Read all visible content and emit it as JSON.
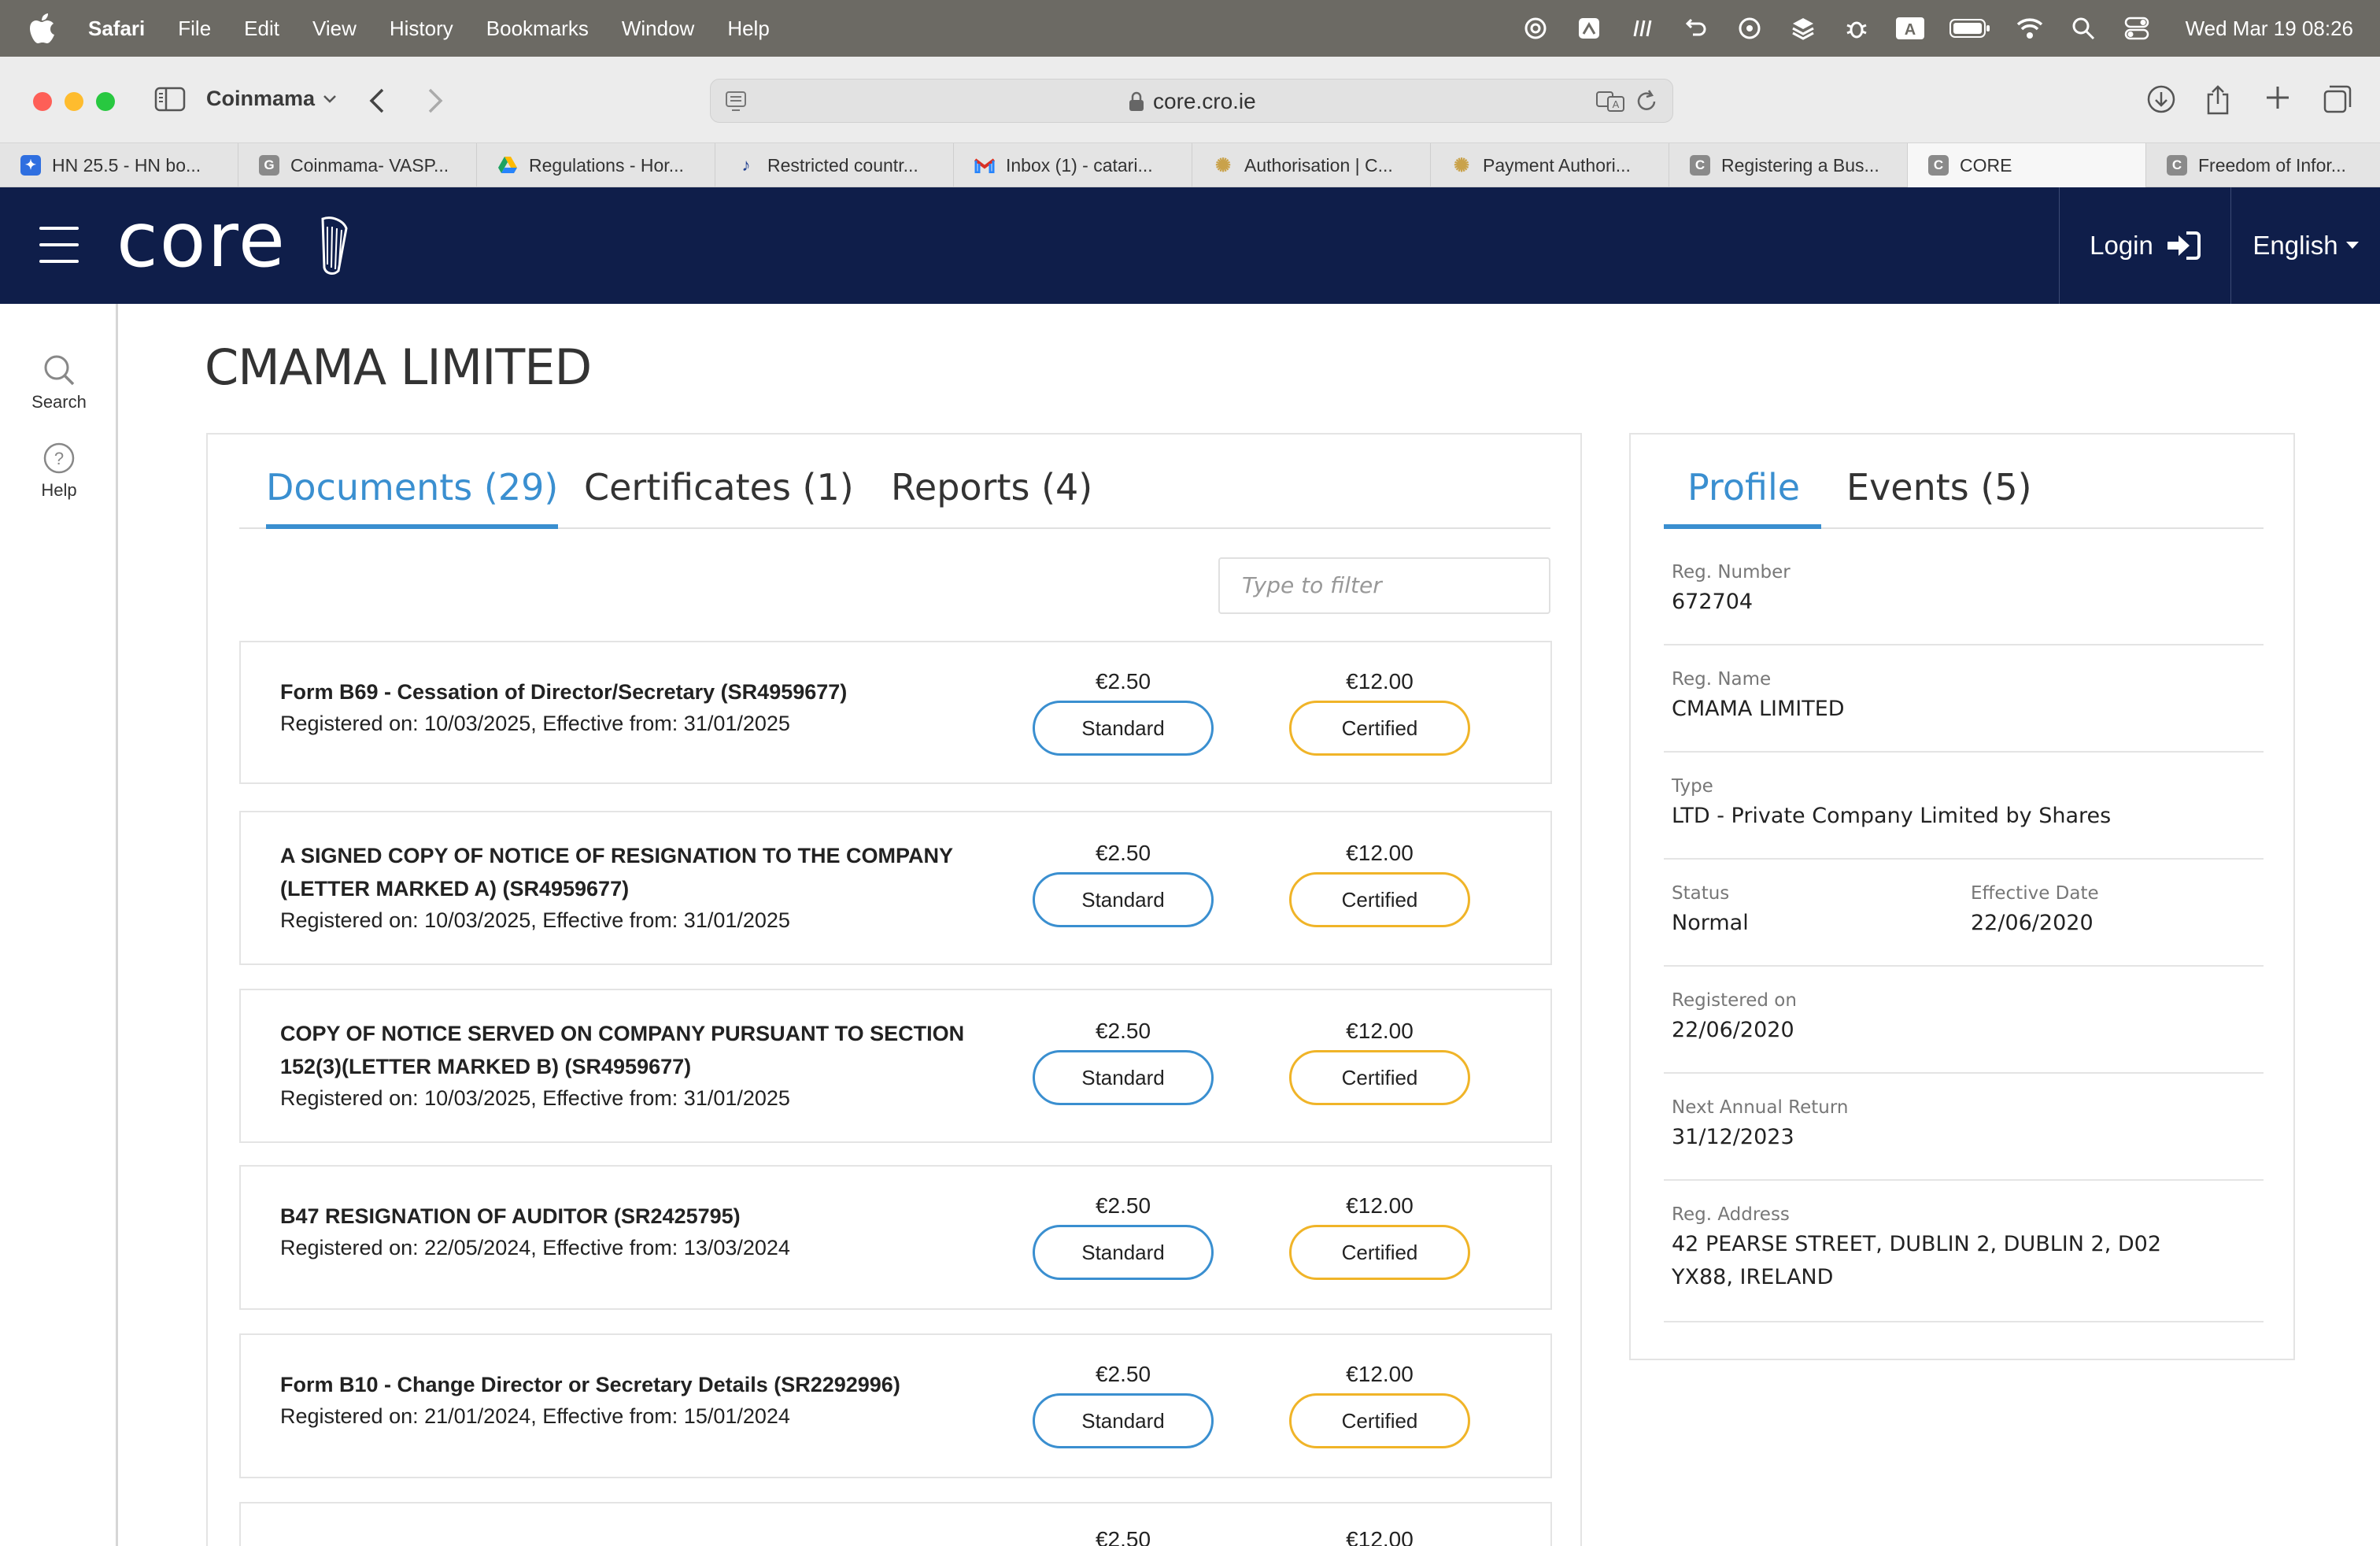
{
  "menubar": {
    "app_name": "Safari",
    "items": [
      "File",
      "Edit",
      "View",
      "History",
      "Bookmarks",
      "Window",
      "Help"
    ],
    "datetime": "Wed Mar 19  08:26"
  },
  "browser": {
    "profile_name": "Coinmama",
    "url": "core.cro.ie",
    "tabs": [
      {
        "label": "HN 25.5 - HN bo...",
        "icon": "jira-icon",
        "color": "#2f6fe0"
      },
      {
        "label": "Coinmama- VASP...",
        "icon": "grey-c-icon",
        "color": "#8a8a8a"
      },
      {
        "label": "Regulations - Hor...",
        "icon": "google-drive-icon",
        "color": "#1ea362"
      },
      {
        "label": "Restricted countr...",
        "icon": "harp-icon",
        "color": "#1f3f8f"
      },
      {
        "label": "Inbox (1) - catari...",
        "icon": "gmail-icon",
        "color": "#d93025"
      },
      {
        "label": "Authorisation | C...",
        "icon": "seal-icon",
        "color": "#c9a24a"
      },
      {
        "label": "Payment Authori...",
        "icon": "seal-icon",
        "color": "#c9a24a"
      },
      {
        "label": "Registering a Bus...",
        "icon": "grey-c-icon",
        "color": "#8a8a8a"
      },
      {
        "label": "CORE",
        "icon": "grey-c-icon",
        "color": "#8a8a8a"
      },
      {
        "label": "Freedom of Infor...",
        "icon": "grey-c-icon",
        "color": "#8a8a8a"
      }
    ]
  },
  "header": {
    "logo_text": "core",
    "login_label": "Login",
    "language_label": "English"
  },
  "rail": {
    "search_label": "Search",
    "help_label": "Help"
  },
  "company": {
    "title": "CMAMA LIMITED"
  },
  "documents_panel": {
    "tabs": [
      "Documents (29)",
      "Certificates (1)",
      "Reports (4)"
    ],
    "filter_placeholder": "Type to filter",
    "documents": [
      {
        "title": "Form B69 - Cessation of Director/Secretary (SR4959677)",
        "meta": "Registered on: 10/03/2025, Effective from: 31/01/2025",
        "standard_price": "€2.50",
        "certified_price": "€12.00",
        "standard_label": "Standard",
        "certified_label": "Certified"
      },
      {
        "title": "A SIGNED COPY OF NOTICE OF RESIGNATION TO THE COMPANY (LETTER MARKED A) (SR4959677)",
        "meta": "Registered on: 10/03/2025, Effective from: 31/01/2025",
        "standard_price": "€2.50",
        "certified_price": "€12.00",
        "standard_label": "Standard",
        "certified_label": "Certified"
      },
      {
        "title": "COPY OF NOTICE SERVED ON COMPANY PURSUANT TO SECTION 152(3)(LETTER MARKED B) (SR4959677)",
        "meta": "Registered on: 10/03/2025, Effective from: 31/01/2025",
        "standard_price": "€2.50",
        "certified_price": "€12.00",
        "standard_label": "Standard",
        "certified_label": "Certified"
      },
      {
        "title": "B47 RESIGNATION OF AUDITOR (SR2425795)",
        "meta": "Registered on: 22/05/2024, Effective from: 13/03/2024",
        "standard_price": "€2.50",
        "certified_price": "€12.00",
        "standard_label": "Standard",
        "certified_label": "Certified"
      },
      {
        "title": "Form B10 - Change Director or Secretary Details (SR2292996)",
        "meta": "Registered on: 21/01/2024, Effective from: 15/01/2024",
        "standard_price": "€2.50",
        "certified_price": "€12.00",
        "standard_label": "Standard",
        "certified_label": "Certified"
      },
      {
        "title": "",
        "meta": "",
        "standard_price": "€2.50",
        "certified_price": "€12.00",
        "standard_label": "",
        "certified_label": ""
      }
    ]
  },
  "profile_panel": {
    "tabs": [
      "Profile",
      "Events (5)"
    ],
    "reg_number_label": "Reg. Number",
    "reg_number": "672704",
    "reg_name_label": "Reg. Name",
    "reg_name": "CMAMA LIMITED",
    "type_label": "Type",
    "type": "LTD - Private Company Limited by Shares",
    "status_label": "Status",
    "status": "Normal",
    "effective_date_label": "Effective Date",
    "effective_date": "22/06/2020",
    "registered_on_label": "Registered on",
    "registered_on": "22/06/2020",
    "next_annual_return_label": "Next Annual Return",
    "next_annual_return": "31/12/2023",
    "reg_address_label": "Reg. Address",
    "reg_address": "42 PEARSE STREET, DUBLIN 2, DUBLIN 2, D02 YX88, IRELAND"
  },
  "colors": {
    "header_bg": "#0f1e4a",
    "accent_blue": "#3a8fd0",
    "certified_yellow": "#f0b428"
  }
}
